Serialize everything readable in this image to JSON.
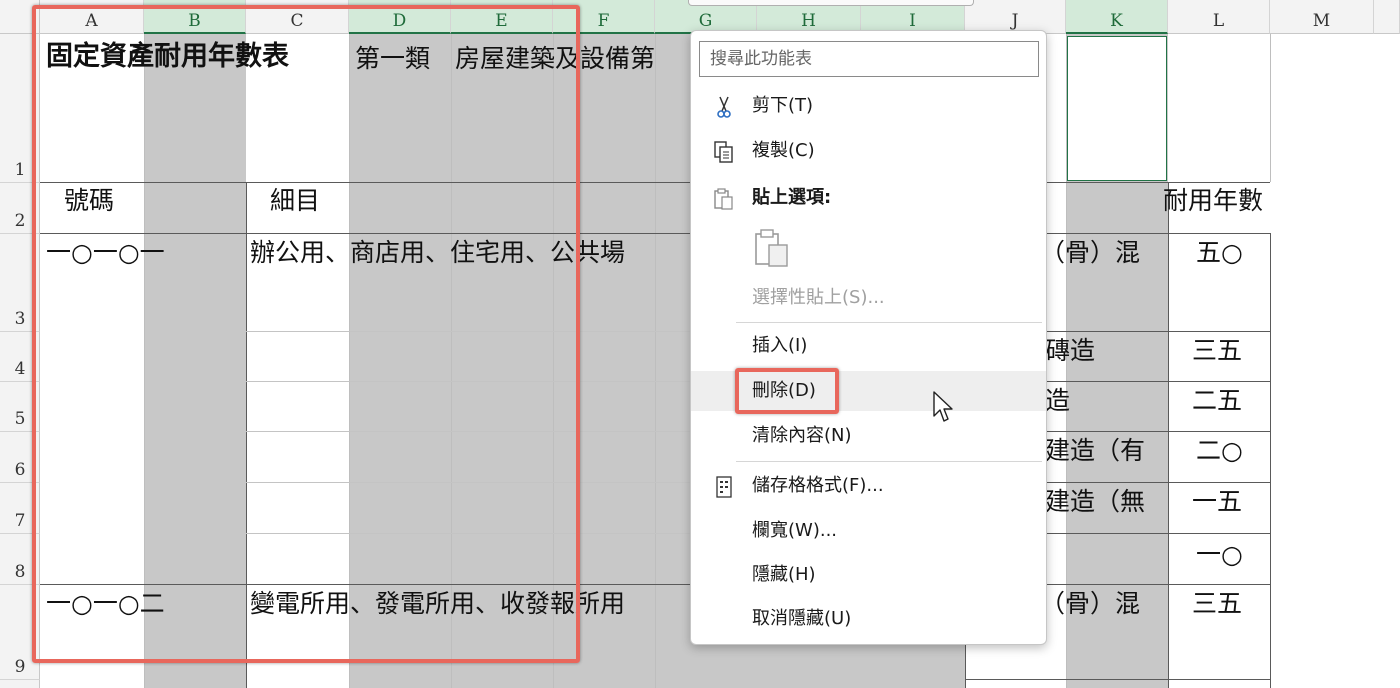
{
  "columns": [
    "A",
    "B",
    "C",
    "D",
    "E",
    "F",
    "G",
    "H",
    "I",
    "J",
    "K",
    "L",
    "M"
  ],
  "rows": [
    "1",
    "2",
    "3",
    "4",
    "5",
    "6",
    "7",
    "8",
    "9"
  ],
  "cells": {
    "title": "固定資產耐用年數表",
    "category": "第一類　房屋建築及設備第",
    "header_code": "號碼",
    "header_item": "細目",
    "header_years": "耐用年數",
    "code_1": "一○一○一",
    "item_1": "辦公用、商店用、住宅用、公共場",
    "code_2": "一○一○二",
    "item_2": "變電所用、發電所用、收發報所用",
    "j3": "（骨）混",
    "j4": "磚造",
    "j5": "造",
    "j6": "建造（有",
    "j7": "建造（無",
    "j9": "（骨）混",
    "l3": "五○",
    "l4": "三五",
    "l5": "二五",
    "l6": "二○",
    "l7": "一五",
    "l8": "一○",
    "l9": "三五"
  },
  "context_menu": {
    "search_placeholder": "搜尋此功能表",
    "items": {
      "cut": "剪下(T)",
      "copy": "複製(C)",
      "paste_options": "貼上選項:",
      "paste_special": "選擇性貼上(S)...",
      "insert": "插入(I)",
      "delete": "刪除(D)",
      "clear": "清除內容(N)",
      "format": "儲存格格式(F)...",
      "col_width": "欄寬(W)...",
      "hide": "隱藏(H)",
      "unhide": "取消隱藏(U)"
    }
  },
  "colors": {
    "selection_green": "#217346",
    "highlight_red": "#e8675c",
    "selected_fill": "#c8c8c8"
  }
}
